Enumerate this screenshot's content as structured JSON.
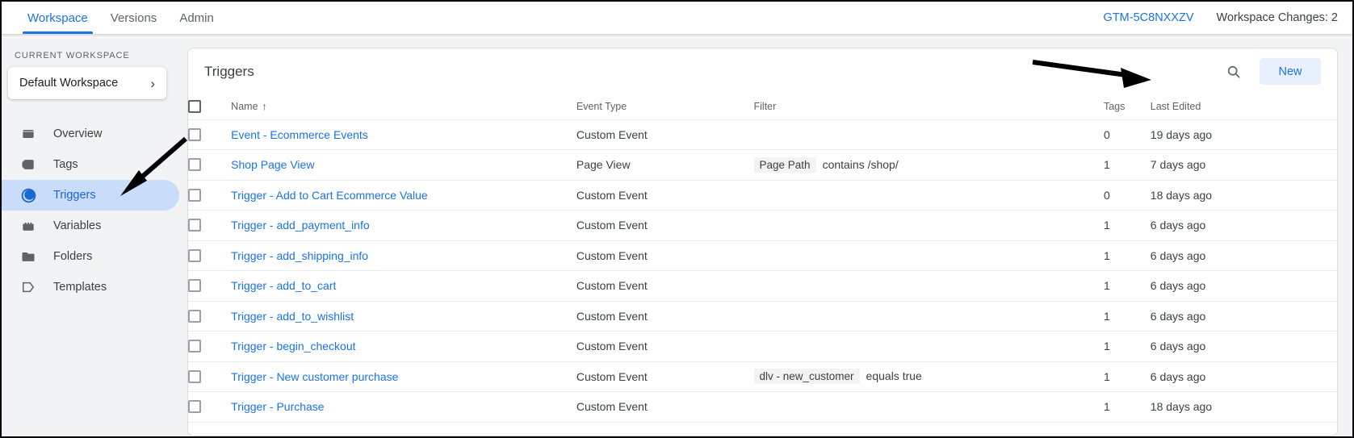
{
  "topbar": {
    "tabs": [
      {
        "label": "Workspace",
        "active": true
      },
      {
        "label": "Versions",
        "active": false
      },
      {
        "label": "Admin",
        "active": false
      }
    ],
    "container_id": "GTM-5C8NXXZV",
    "workspace_changes": "Workspace Changes: 2"
  },
  "sidebar": {
    "section_label": "CURRENT WORKSPACE",
    "workspace_name": "Default Workspace",
    "chevron": "›",
    "items": [
      {
        "label": "Overview",
        "icon": "overview-icon",
        "active": false
      },
      {
        "label": "Tags",
        "icon": "tag-icon",
        "active": false
      },
      {
        "label": "Triggers",
        "icon": "trigger-icon",
        "active": true
      },
      {
        "label": "Variables",
        "icon": "variables-icon",
        "active": false
      },
      {
        "label": "Folders",
        "icon": "folder-icon",
        "active": false
      },
      {
        "label": "Templates",
        "icon": "template-icon",
        "active": false
      }
    ]
  },
  "panel": {
    "title": "Triggers",
    "search_icon": "search-icon",
    "new_button": "New",
    "columns": [
      {
        "key": "name",
        "label": "Name",
        "sort": "↑"
      },
      {
        "key": "type",
        "label": "Event Type",
        "sort": ""
      },
      {
        "key": "filter",
        "label": "Filter",
        "sort": ""
      },
      {
        "key": "tags",
        "label": "Tags",
        "sort": ""
      },
      {
        "key": "edited",
        "label": "Last Edited",
        "sort": ""
      }
    ],
    "rows": [
      {
        "name": "Event - Ecommerce Events",
        "type": "Custom Event",
        "filter_chip": "",
        "filter_op": "",
        "tags": "0",
        "edited": "19 days ago"
      },
      {
        "name": "Shop Page View",
        "type": "Page View",
        "filter_chip": "Page Path",
        "filter_op": "contains /shop/",
        "tags": "1",
        "edited": "7 days ago"
      },
      {
        "name": "Trigger - Add to Cart Ecommerce Value",
        "type": "Custom Event",
        "filter_chip": "",
        "filter_op": "",
        "tags": "0",
        "edited": "18 days ago"
      },
      {
        "name": "Trigger - add_payment_info",
        "type": "Custom Event",
        "filter_chip": "",
        "filter_op": "",
        "tags": "1",
        "edited": "6 days ago"
      },
      {
        "name": "Trigger - add_shipping_info",
        "type": "Custom Event",
        "filter_chip": "",
        "filter_op": "",
        "tags": "1",
        "edited": "6 days ago"
      },
      {
        "name": "Trigger - add_to_cart",
        "type": "Custom Event",
        "filter_chip": "",
        "filter_op": "",
        "tags": "1",
        "edited": "6 days ago"
      },
      {
        "name": "Trigger - add_to_wishlist",
        "type": "Custom Event",
        "filter_chip": "",
        "filter_op": "",
        "tags": "1",
        "edited": "6 days ago"
      },
      {
        "name": "Trigger - begin_checkout",
        "type": "Custom Event",
        "filter_chip": "",
        "filter_op": "",
        "tags": "1",
        "edited": "6 days ago"
      },
      {
        "name": "Trigger - New customer purchase",
        "type": "Custom Event",
        "filter_chip": "dlv - new_customer",
        "filter_op": "equals true",
        "tags": "1",
        "edited": "6 days ago"
      },
      {
        "name": "Trigger - Purchase",
        "type": "Custom Event",
        "filter_chip": "",
        "filter_op": "",
        "tags": "1",
        "edited": "18 days ago"
      }
    ]
  },
  "annotations": [
    {
      "name": "arrow-to-triggers-nav"
    },
    {
      "name": "arrow-to-search-icon"
    }
  ],
  "colors": {
    "accent": "#1a73e8",
    "sidebar_bg": "#f1f3f4",
    "active_nav_bg": "#c9ddfb",
    "new_btn_bg": "#e8f0fe",
    "border": "#dadce0"
  }
}
